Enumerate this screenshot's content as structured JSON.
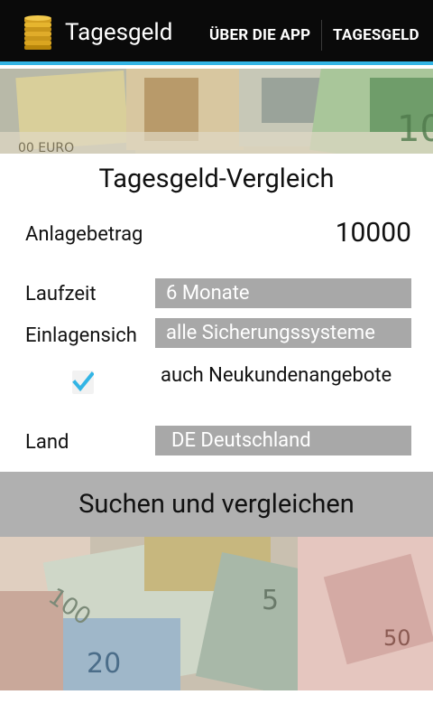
{
  "action_bar": {
    "app_icon": "gold-coins-stack-icon",
    "title": "Tagesgeld",
    "menu": [
      "ÜBER DIE APP",
      "TAGESGELD"
    ]
  },
  "form": {
    "heading": "Tagesgeld-Vergleich",
    "amount": {
      "label": "Anlagebetrag",
      "value": "10000"
    },
    "term": {
      "label": "Laufzeit",
      "selected": "6 Monate"
    },
    "deposit_protection": {
      "label": "Einlagensich",
      "selected": "alle Sicherungssysteme"
    },
    "new_customer_offers": {
      "label": "auch Neukundenangebote",
      "checked": true
    },
    "country": {
      "label": "Land",
      "selected": "DE Deutschland"
    },
    "submit_label": "Suchen und vergleichen"
  },
  "colors": {
    "action_bar_bg": "#0a0a0a",
    "action_bar_accent": "#33b5e5",
    "field_bg": "#a8a8a8",
    "button_bg": "#b0b0b0",
    "checkmark": "#33b5e5"
  }
}
